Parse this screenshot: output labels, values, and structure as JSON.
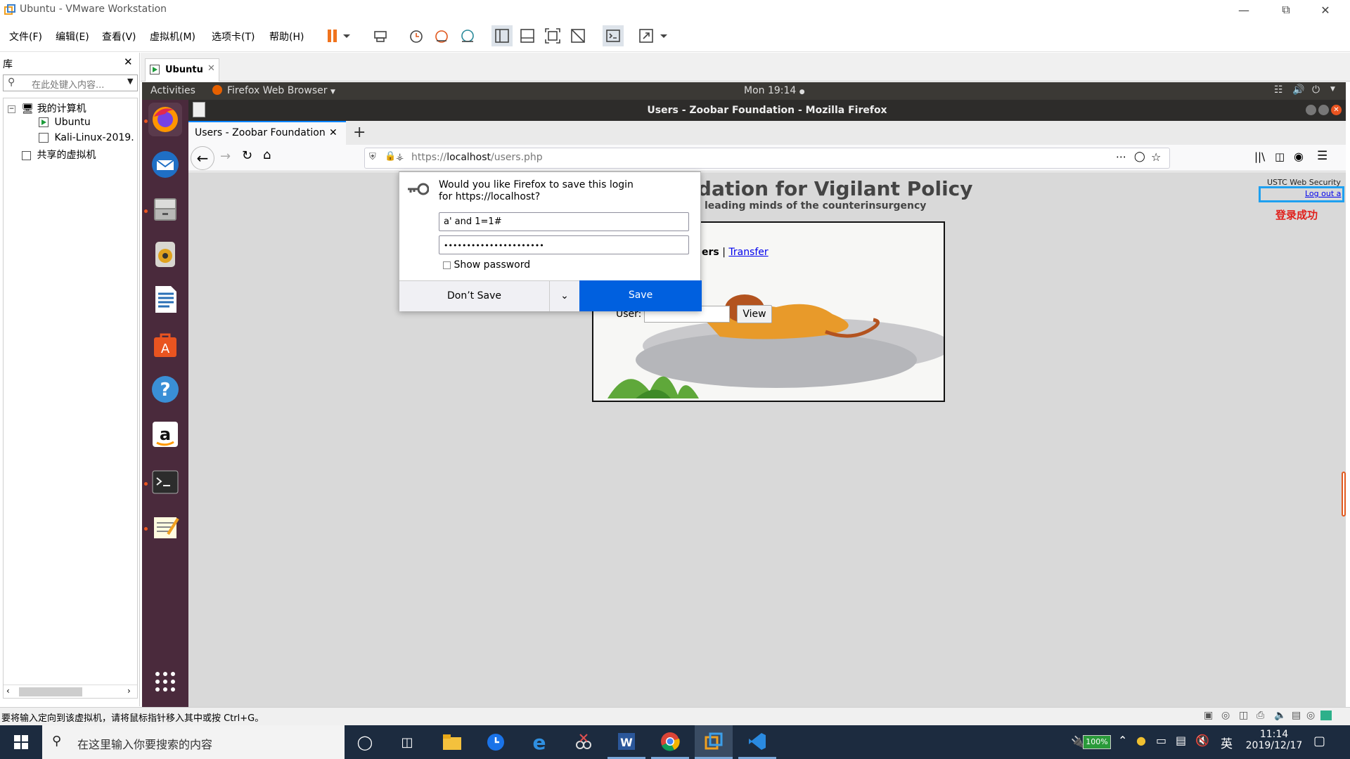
{
  "window": {
    "title": "Ubuntu - VMware Workstation"
  },
  "menu": {
    "items": [
      "文件(F)",
      "编辑(E)",
      "查看(V)",
      "虚拟机(M)",
      "选项卡(T)",
      "帮助(H)"
    ]
  },
  "library": {
    "header": "库",
    "search_placeholder": "在此处键入内容...",
    "tree": {
      "root": "我的计算机",
      "children": [
        "Ubuntu",
        "Kali-Linux-2019."
      ],
      "shared": "共享的虚拟机"
    }
  },
  "vm_tab": {
    "label": "Ubuntu"
  },
  "ubuntu": {
    "activities": "Activities",
    "app_menu": "Firefox Web Browser",
    "clock": "Mon 19:14",
    "dock": [
      "firefox-icon",
      "thunderbird-icon",
      "files-icon",
      "rhythmbox-icon",
      "writer-icon",
      "software-icon",
      "help-icon",
      "amazon-icon",
      "terminal-icon",
      "text-editor-icon",
      "app-grid-icon"
    ]
  },
  "firefox": {
    "window_title": "Users - Zoobar Foundation - Mozilla Firefox",
    "tab_title": "Users - Zoobar Foundation",
    "url_prefix": "https://",
    "url_host": "localhost",
    "url_path": "/users.php"
  },
  "page": {
    "heading": "ndation for Vigilant Policy",
    "subheading": "leading minds of the counterinsurgency",
    "corner_title": "USTC Web Security",
    "logout": "Log out a",
    "annotation": "登录成功",
    "nav_users": "ers",
    "nav_sep": "|",
    "nav_transfer": "Transfer",
    "user_label": "User:",
    "view_button": "View"
  },
  "save_login": {
    "prompt": "Would you like Firefox to save this login for https://localhost?",
    "username": "a' and 1=1#",
    "password_mask": "••••••••••••••••••••••",
    "show_password": "Show password",
    "dont_save": "Don’t Save",
    "save": "Save"
  },
  "status": {
    "message": "要将输入定向到该虚拟机，请将鼠标指针移入其中或按 Ctrl+G。"
  },
  "taskbar": {
    "search_placeholder": "在这里输入你要搜索的内容",
    "battery": "100%",
    "ime": "英",
    "time": "11:14",
    "date": "2019/12/17"
  },
  "colors": {
    "ubuntu_dock": "#4a2a3c",
    "ubuntu_topbar": "#3b3935",
    "firefox_blue": "#0060df",
    "taskbar": "#1c2b3f",
    "annotation_red": "#e0201b",
    "highlight_blue": "#1ea0f0"
  }
}
